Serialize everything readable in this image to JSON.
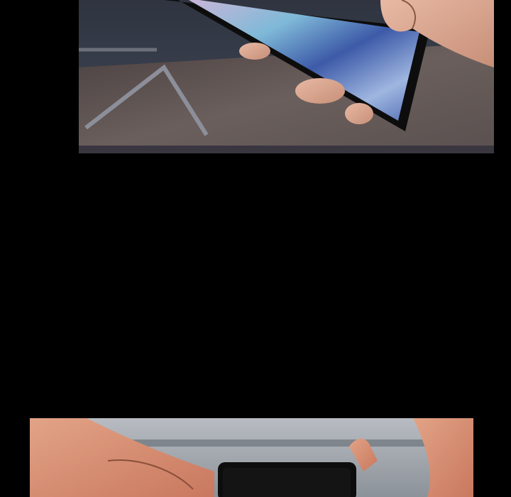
{
  "background_color": "#000000",
  "panels": [
    {
      "name": "panel-top",
      "description_icon": "hand-holding-phone-illustration",
      "colors": {
        "floor": "#5a4f4c",
        "wall": "#3b4250",
        "skin": "#d9a48e",
        "phone_body": "#111111",
        "screen_primary": "#6f86c9"
      }
    },
    {
      "name": "panel-bottom",
      "description_icon": "hands-holding-phone-illustration",
      "colors": {
        "wall": "#9aa0a6",
        "skin": "#d58a6e",
        "phone_body": "#0d0d0d"
      }
    }
  ]
}
